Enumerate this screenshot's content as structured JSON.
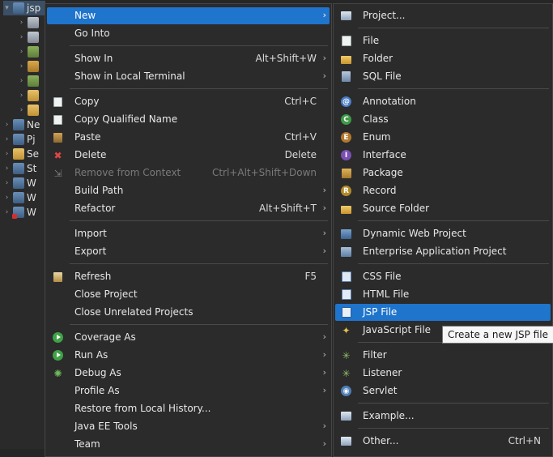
{
  "tree": {
    "items": [
      {
        "label": "jsp",
        "top": 0,
        "indent": 4,
        "icon": "project-icon"
      },
      {
        "label": "",
        "icon": "deployment-descriptor-icon"
      },
      {
        "label": "",
        "icon": "jax-ws-icon"
      },
      {
        "label": "",
        "icon": "java-resources-icon"
      },
      {
        "label": "",
        "icon": "libraries-icon"
      },
      {
        "label": "",
        "icon": "javascript-resources-icon"
      },
      {
        "label": "",
        "icon": "build-folder-icon"
      },
      {
        "label": "",
        "icon": "webapp-folder-icon"
      },
      {
        "label": "Ne",
        "icon": "project-icon"
      },
      {
        "label": "Pj",
        "icon": "project-icon"
      },
      {
        "label": "Se",
        "icon": "servers-icon"
      },
      {
        "label": "St",
        "icon": "project-icon"
      },
      {
        "label": "W",
        "icon": "project-icon"
      },
      {
        "label": "W",
        "icon": "project-icon"
      },
      {
        "label": "W",
        "icon": "project-icon"
      }
    ]
  },
  "context_menu": {
    "items": [
      {
        "label": "New",
        "submenu": true,
        "selected": true
      },
      {
        "label": "Go Into"
      },
      {
        "label": "Show In",
        "accel": "Alt+Shift+W",
        "submenu": true
      },
      {
        "label": "Show in Local Terminal",
        "submenu": true
      },
      {
        "label": "Copy",
        "accel": "Ctrl+C"
      },
      {
        "label": "Copy Qualified Name"
      },
      {
        "label": "Paste",
        "accel": "Ctrl+V"
      },
      {
        "label": "Delete",
        "accel": "Delete"
      },
      {
        "label": "Remove from Context",
        "accel": "Ctrl+Alt+Shift+Down",
        "disabled": true
      },
      {
        "label": "Build Path",
        "submenu": true
      },
      {
        "label": "Refactor",
        "accel": "Alt+Shift+T",
        "submenu": true
      },
      {
        "label": "Import",
        "submenu": true
      },
      {
        "label": "Export",
        "submenu": true
      },
      {
        "label": "Refresh",
        "accel": "F5"
      },
      {
        "label": "Close Project"
      },
      {
        "label": "Close Unrelated Projects"
      },
      {
        "label": "Coverage As",
        "submenu": true
      },
      {
        "label": "Run As",
        "submenu": true
      },
      {
        "label": "Debug As",
        "submenu": true
      },
      {
        "label": "Profile As",
        "submenu": true
      },
      {
        "label": "Restore from Local History..."
      },
      {
        "label": "Java EE Tools",
        "submenu": true
      },
      {
        "label": "Team",
        "submenu": true
      }
    ]
  },
  "new_submenu": {
    "items": [
      {
        "label": "Project..."
      },
      {
        "label": "File"
      },
      {
        "label": "Folder"
      },
      {
        "label": "SQL File"
      },
      {
        "label": "Annotation"
      },
      {
        "label": "Class"
      },
      {
        "label": "Enum"
      },
      {
        "label": "Interface"
      },
      {
        "label": "Package"
      },
      {
        "label": "Record"
      },
      {
        "label": "Source Folder"
      },
      {
        "label": "Dynamic Web Project"
      },
      {
        "label": "Enterprise Application Project"
      },
      {
        "label": "CSS File"
      },
      {
        "label": "HTML File"
      },
      {
        "label": "JSP File",
        "selected": true
      },
      {
        "label": "JavaScript File"
      },
      {
        "label": "Filter"
      },
      {
        "label": "Listener"
      },
      {
        "label": "Servlet"
      },
      {
        "label": "Example..."
      },
      {
        "label": "Other...",
        "accel": "Ctrl+N"
      }
    ]
  },
  "tooltip": {
    "text": "Create a new JSP file"
  },
  "colors": {
    "selection": "#1f74cc",
    "menu_bg": "#2b2b2b",
    "tree_bg": "#2a2a2b"
  }
}
